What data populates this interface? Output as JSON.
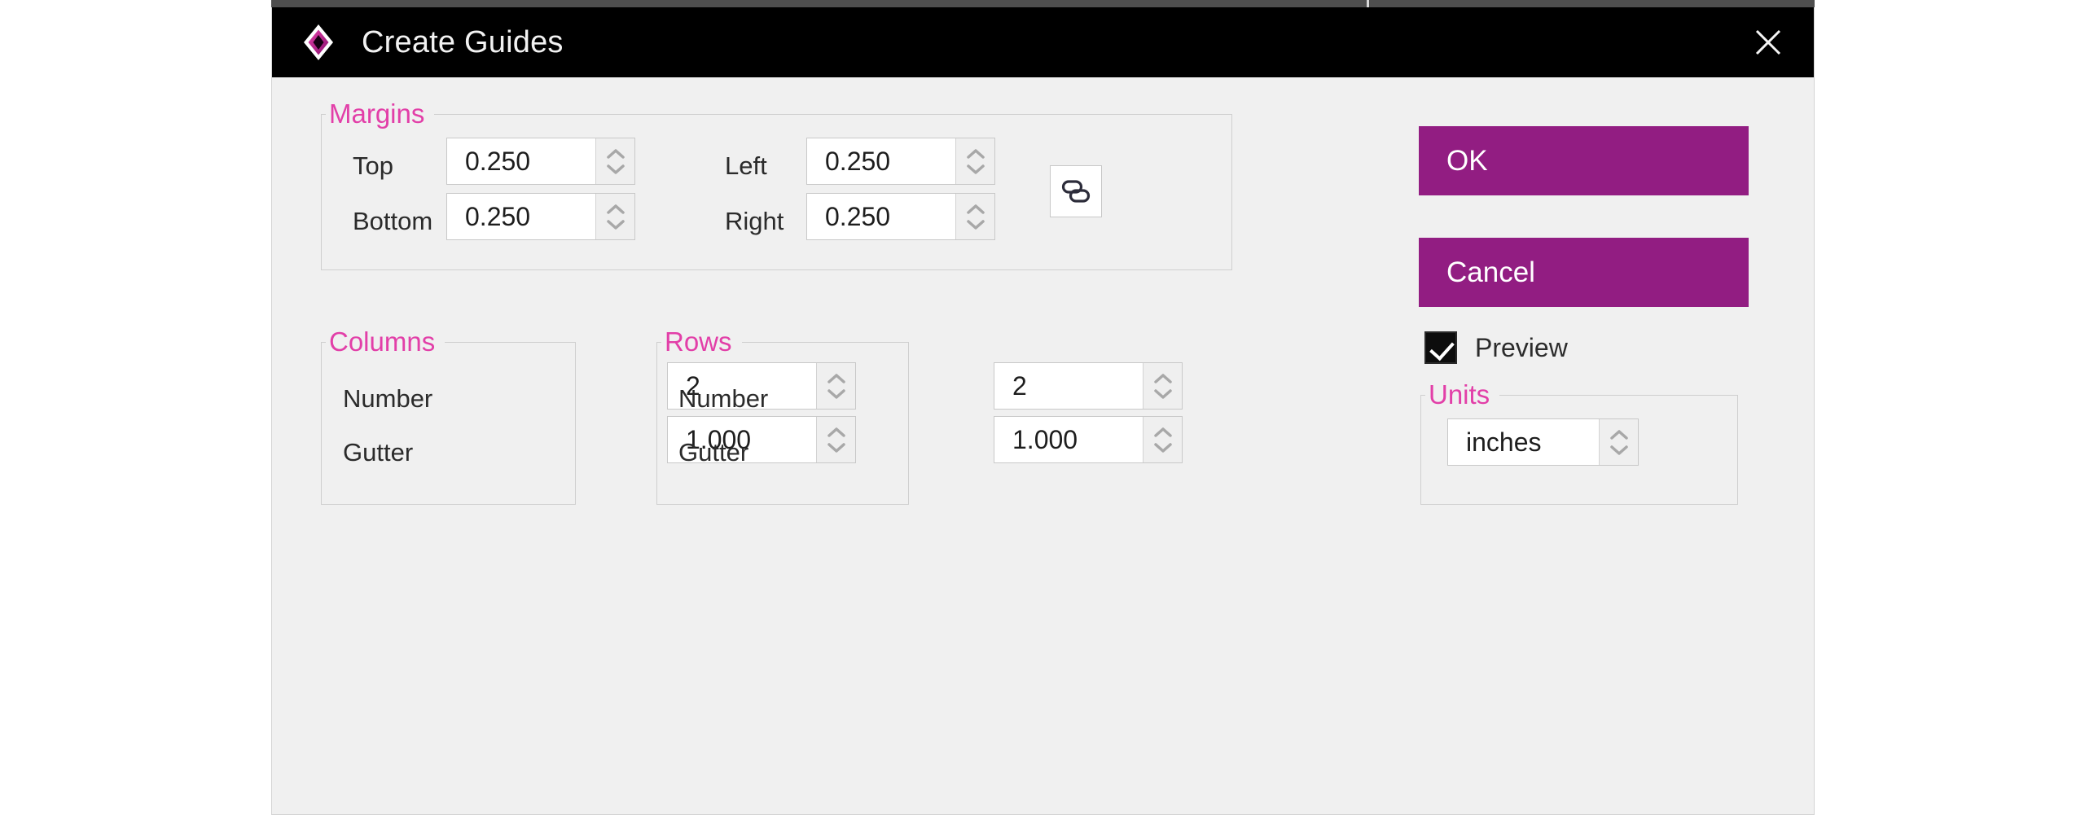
{
  "window": {
    "title": "Create Guides",
    "app_icon": "affinity-diamond-icon",
    "close_icon": "close-icon",
    "accent_color": "#921d82",
    "legend_color": "#e23fa8",
    "titlebar_bg": "#000000",
    "dialog_bg": "#f0f0f0"
  },
  "margins": {
    "legend": "Margins",
    "fields": [
      {
        "label": "Top",
        "value": "0.250"
      },
      {
        "label": "Bottom",
        "value": "0.250"
      },
      {
        "label": "Left",
        "value": "0.250"
      },
      {
        "label": "Right",
        "value": "0.250"
      }
    ],
    "link_button": {
      "icon": "link-icon",
      "tooltip": "Link margins"
    }
  },
  "columns": {
    "legend": "Columns",
    "fields": [
      {
        "label": "Number",
        "value": "2"
      },
      {
        "label": "Gutter",
        "value": "1.000"
      }
    ]
  },
  "rows": {
    "legend": "Rows",
    "fields": [
      {
        "label": "Number",
        "value": "2"
      },
      {
        "label": "Gutter",
        "value": "1.000"
      }
    ]
  },
  "units": {
    "legend": "Units",
    "value": "inches"
  },
  "actions": {
    "ok_label": "OK",
    "cancel_label": "Cancel",
    "preview_label": "Preview",
    "preview_checked": true
  }
}
